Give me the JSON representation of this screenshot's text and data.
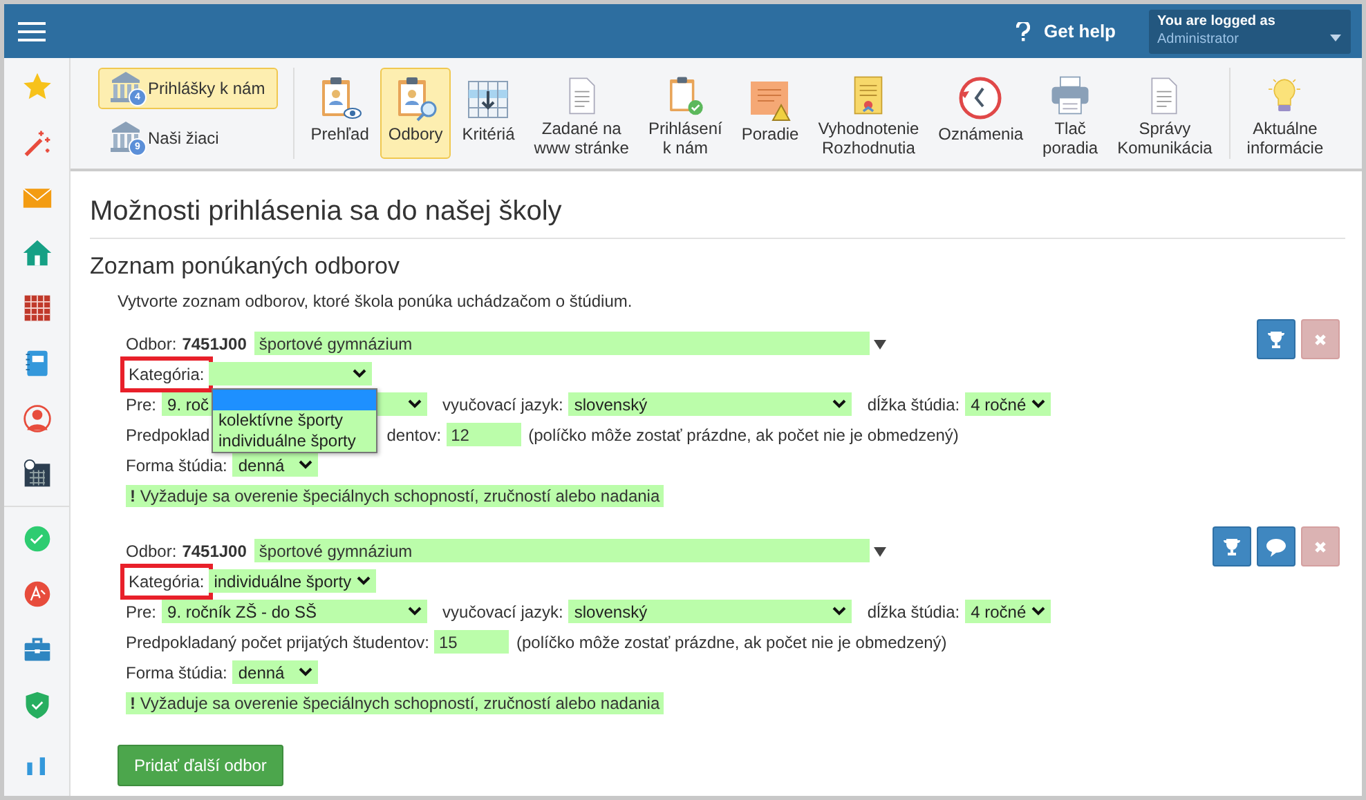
{
  "topbar": {
    "help": "Get help",
    "user_label": "You are logged as",
    "user_name": "Administrator"
  },
  "toolbar": {
    "left_buttons": [
      {
        "label": "Prihlášky k nám",
        "badge": "4",
        "selected": true
      },
      {
        "label": "Naši žiaci",
        "badge": "9",
        "selected": false
      }
    ],
    "items": [
      {
        "label": "Prehľad",
        "selected": false
      },
      {
        "label": "Odbory",
        "selected": true
      },
      {
        "label": "Kritériá",
        "selected": false
      },
      {
        "label": "Zadané na\nwww stránke",
        "selected": false
      },
      {
        "label": "Prihlásení\nk nám",
        "selected": false
      },
      {
        "label": "Poradie",
        "selected": false
      },
      {
        "label": "Vyhodnotenie\nRozhodnutia",
        "selected": false
      },
      {
        "label": "Oznámenia",
        "selected": false
      },
      {
        "label": "Tlač\nporadia",
        "selected": false
      },
      {
        "label": "Správy\nKomunikácia",
        "selected": false
      }
    ],
    "extra_items": [
      {
        "label": "Aktuálne\ninformácie",
        "selected": false
      }
    ]
  },
  "page_title": "Možnosti prihlásenia sa do našej školy",
  "section_title": "Zoznam ponúkaných odborov",
  "intro": "Vytvorte zoznam odborov, ktoré škola ponúka uchádzačom o štúdium.",
  "programs": [
    {
      "odbor_label": "Odbor:",
      "code": "7451J00",
      "name": "športové gymnázium",
      "category_label": "Kategória:",
      "category_highlighted": true,
      "dropdown": {
        "options": [
          {
            "selected": true
          },
          {
            "label": "kolektívne športy",
            "selected": false
          },
          {
            "label": "individuálne športy",
            "selected": false
          }
        ]
      },
      "pre_label": "Pre:",
      "pre_value": "9. roč",
      "jazyk_label": "vyučovací jazyk:",
      "jazyk_value": "slovenský",
      "dlzka_label": "dĺžka štúdia:",
      "dlzka_value": "4 ročné",
      "count_label": [
        "Predpoklad",
        "dentov:"
      ],
      "count_value": "12",
      "count_note": "(políčko môže zostať prázdne, ak počet nie je obmedzený)",
      "forma_label": "Forma štúdia:",
      "forma_value": "denná",
      "note_mark": "!",
      "note": "Vyžaduje sa overenie špeciálnych schopností, zručností alebo nadania",
      "actions": [
        {
          "kind": "trophy"
        },
        {
          "kind": "delete"
        }
      ]
    },
    {
      "odbor_label": "Odbor:",
      "code": "7451J00",
      "name": "športové gymnázium",
      "category_label": "Kategória:",
      "category_highlighted": true,
      "category_value": "individuálne športy",
      "pre_label": "Pre:",
      "pre_value": "9. ročník ZŠ - do SŠ",
      "jazyk_label": "vyučovací jazyk:",
      "jazyk_value": "slovenský",
      "dlzka_label": "dĺžka štúdia:",
      "dlzka_value": "4 ročné",
      "count_label": [
        "Predpokladaný počet prijatých študentov:"
      ],
      "count_value": "15",
      "count_note": "(políčko môže zostať prázdne, ak počet nie je obmedzený)",
      "forma_label": "Forma štúdia:",
      "forma_value": "denná",
      "note_mark": "!",
      "note": "Vyžaduje sa overenie špeciálnych schopností, zručností alebo nadania",
      "actions": [
        {
          "kind": "trophy"
        },
        {
          "kind": "comment"
        },
        {
          "kind": "delete"
        }
      ]
    }
  ],
  "add_button": "Pridať ďalší odbor"
}
